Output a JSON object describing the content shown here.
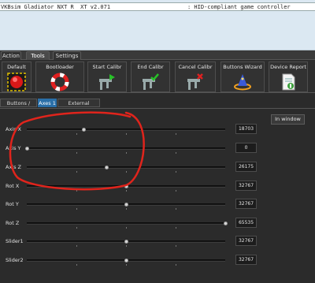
{
  "device": {
    "name": "VKBsim Gladiator NXT R  XT v2.071",
    "type": ": HID-compliant game controller"
  },
  "tabs": [
    "Action",
    "Tools",
    "Settings"
  ],
  "toolbar": {
    "default_label": "Default",
    "bootloader_label": "Bootloader",
    "start_calibr_label": "Start Calibr",
    "end_calibr_label": "End Calibr",
    "cancel_calibr_label": "Cancel Calibr",
    "buttons_wizard_label": "Buttons Wizard",
    "device_report_label": "Device Report"
  },
  "subtabs": [
    "Buttons / POVs",
    "Axes 1",
    "External Devices"
  ],
  "in_window_label": "In window",
  "axes": [
    {
      "label": "Axis X",
      "value": "18703",
      "fraction": 0.285
    },
    {
      "label": "Axis Y",
      "value": "0",
      "fraction": 0.0
    },
    {
      "label": "Axis Z",
      "value": "26175",
      "fraction": 0.399
    },
    {
      "label": "Rot X",
      "value": "32767",
      "fraction": 0.5
    },
    {
      "label": "Rot Y",
      "value": "32767",
      "fraction": 0.5
    },
    {
      "label": "Rot Z",
      "value": "65535",
      "fraction": 1.0
    },
    {
      "label": "Slider1",
      "value": "32767",
      "fraction": 0.5
    },
    {
      "label": "Slider2",
      "value": "32767",
      "fraction": 0.5
    }
  ],
  "colors": {
    "active_subtab": "#2a6fa8",
    "annotation_circle": "#e0241c"
  },
  "icons": [
    "red-button-icon",
    "lifebuoy-icon",
    "caliper-play-icon",
    "caliper-check-icon",
    "caliper-cancel-icon",
    "wizard-hat-icon",
    "report-document-icon"
  ]
}
